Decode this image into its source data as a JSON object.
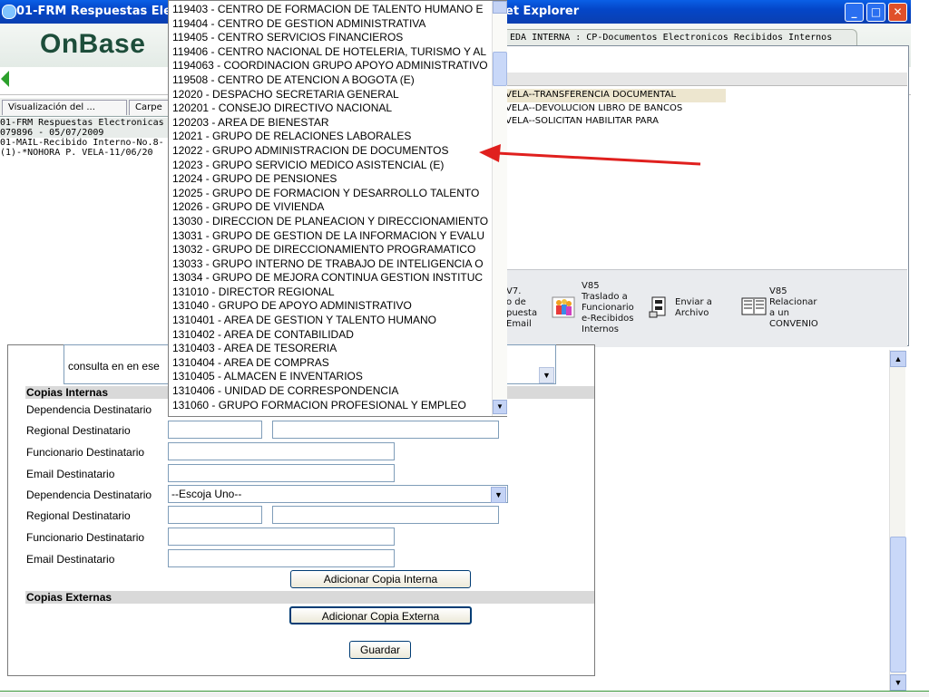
{
  "window": {
    "title_left": "01-FRM Respuestas Electro",
    "title_right": "et Explorer",
    "minimize": "_",
    "maximize": "□",
    "close": "✕"
  },
  "header": {
    "logo": "OnBase",
    "right_tab": "EDA INTERNA : CP-Documentos Electronicos Recibidos Internos"
  },
  "left_panel": {
    "tabs": [
      "Visualización del ...",
      "Carpe"
    ],
    "lines": [
      "01-FRM Respuestas Electronicas",
      "079896 - 05/07/2009",
      "01-MAIL-Recibido Interno-No.8-",
      "(1)-*NOHORA P. VELA-11/06/20"
    ]
  },
  "right_panel": {
    "rows": [
      "VELA--TRANSFERENCIA DOCUMENTAL",
      "VELA--DEVOLUCION LIBRO DE BANCOS",
      "VELA--SOLICITAN HABILITAR PARA"
    ],
    "tools": [
      {
        "label": "V7.\no de\npuesta\nEmail",
        "icon": "none"
      },
      {
        "label": "V85\nTraslado a\nFuncionario\ne-Recibidos\nInternos",
        "icon": "people-icon"
      },
      {
        "label": "Enviar a\nArchivo",
        "icon": "archive-icon"
      },
      {
        "label": "V85\nRelacionar\na un\nCONVENIO",
        "icon": "book-icon"
      }
    ]
  },
  "dropdown_options": [
    "119403 - CENTRO DE FORMACION DE TALENTO HUMANO E",
    "119404 - CENTRO DE GESTION ADMINISTRATIVA",
    "119405 - CENTRO SERVICIOS FINANCIEROS",
    "119406 - CENTRO NACIONAL DE HOTELERIA, TURISMO Y AL",
    "1194063 - COORDINACION GRUPO APOYO ADMINISTRATIVO",
    "119508 - CENTRO DE ATENCION A BOGOTA (E)",
    "12020 - DESPACHO SECRETARIA GENERAL",
    "120201 - CONSEJO DIRECTIVO NACIONAL",
    "120203 - AREA DE BIENESTAR",
    "12021 - GRUPO DE RELACIONES LABORALES",
    "12022 - GRUPO ADMINISTRACION DE DOCUMENTOS",
    "12023 - GRUPO SERVICIO MEDICO ASISTENCIAL (E)",
    "12024 - GRUPO DE PENSIONES",
    "12025 - GRUPO DE FORMACION Y DESARROLLO TALENTO",
    "12026 - GRUPO DE VIVIENDA",
    "13030 - DIRECCION DE PLANEACION Y DIRECCIONAMIENTO",
    "13031 - GRUPO DE GESTION DE LA INFORMACION Y EVALU",
    "13032 - GRUPO DE DIRECCIONAMIENTO PROGRAMATICO",
    "13033 - GRUPO INTERNO DE TRABAJO DE INTELIGENCIA O",
    "13034 - GRUPO DE MEJORA CONTINUA GESTION INSTITUC",
    "131010 - DIRECTOR REGIONAL",
    "131040 - GRUPO DE APOYO ADMINISTRATIVO",
    "1310401 - AREA DE GESTION Y TALENTO HUMANO",
    "1310402 - AREA DE CONTABILIDAD",
    "1310403 - AREA DE TESORERIA",
    "1310404 - AREA DE COMPRAS",
    "1310405 - ALMACEN E INVENTARIOS",
    "1310406 - UNIDAD DE CORRESPONDENCIA",
    "131060 - GRUPO FORMACION PROFESIONAL Y EMPLEO"
  ],
  "form": {
    "comment_text": "consulta en en ese",
    "section_internas": "Copias Internas",
    "section_externas": "Copias Externas",
    "labels": {
      "dependencia": "Dependencia Destinatario",
      "regional": "Regional Destinatario",
      "funcionario": "Funcionario Destinatario",
      "email": "Email Destinatario"
    },
    "select_default": "--Escoja Uno--",
    "add_internal": "Adicionar Copia Interna",
    "add_external": "Adicionar Copia Externa",
    "save": "Guardar"
  },
  "colors": {
    "title_bar": "#0446c8",
    "logo": "#1d4d3a",
    "annotation_arrow": "#e0201e"
  }
}
